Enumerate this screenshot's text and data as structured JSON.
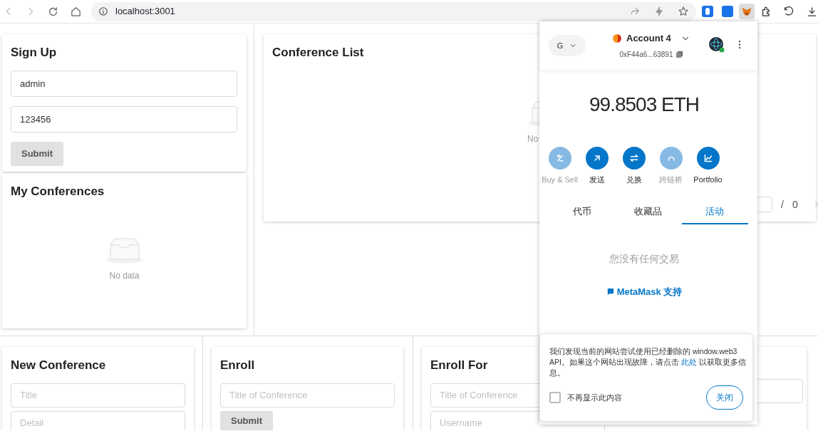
{
  "browser": {
    "url": "localhost:3001"
  },
  "sign_up": {
    "title": "Sign Up",
    "fields": [
      {
        "value": "admin"
      },
      {
        "value": "123456"
      }
    ],
    "button": "Submit"
  },
  "my_conferences": {
    "title": "My Conferences",
    "empty_text": "No data"
  },
  "conference_list": {
    "title": "Conference List",
    "empty_text": "No",
    "pagination": {
      "separator": "/",
      "total": "0"
    }
  },
  "new_conference": {
    "title": "New Conference",
    "fields": [
      {
        "placeholder": "Title"
      },
      {
        "placeholder": "Detail"
      }
    ]
  },
  "enroll": {
    "title": "Enroll",
    "fields": [
      {
        "placeholder": "Title of Conference"
      }
    ],
    "button": "Submit"
  },
  "enroll_for": {
    "title": "Enroll For",
    "fields": [
      {
        "placeholder": "Title of Conference"
      },
      {
        "placeholder": "Username"
      }
    ]
  },
  "wallet": {
    "network": "G",
    "account": "Account 4",
    "address": "0xF44a6...63891",
    "balance": "99.8503 ETH",
    "actions": [
      {
        "kind": "plus-minus",
        "label": "Buy & Sell",
        "disabled": true
      },
      {
        "kind": "send",
        "label": "发送",
        "disabled": false
      },
      {
        "kind": "swap",
        "label": "兑换",
        "disabled": false
      },
      {
        "kind": "bridge",
        "label": "跨链桥",
        "disabled": true
      },
      {
        "kind": "chart",
        "label": "Portfolio",
        "disabled": false
      }
    ],
    "tabs": [
      {
        "label": "代币",
        "selected": false
      },
      {
        "label": "收藏品",
        "selected": false
      },
      {
        "label": "活动",
        "selected": true
      }
    ],
    "empty_text": "您没有任何交易",
    "support_link": "MetaMask 支持",
    "notice": {
      "text": "我们发现当前的网站尝试使用已经删除的 window.web3 API。如果这个网站出现故障，请点击 ",
      "link": "此处",
      "text_after": " 以获取更多信息。",
      "checkbox": {
        "label": "不再显示此内容",
        "checked": false
      },
      "button": "关闭"
    }
  }
}
